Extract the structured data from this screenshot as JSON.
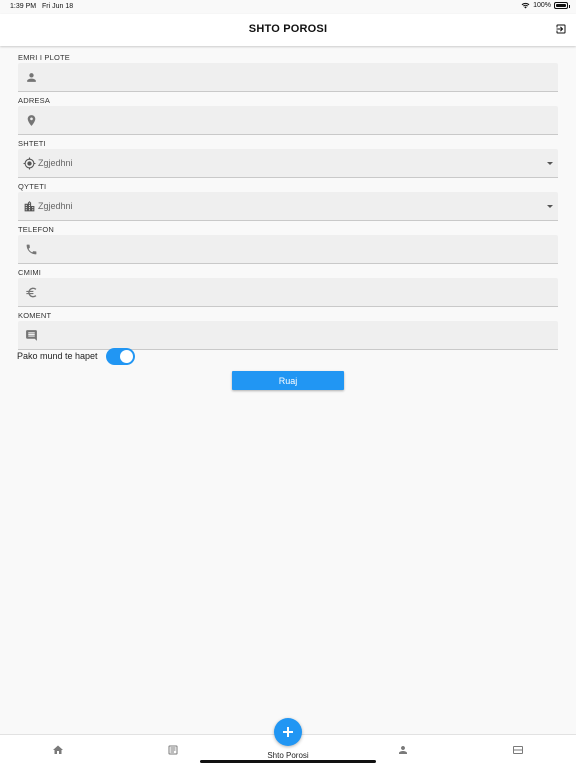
{
  "status_bar": {
    "time": "1:39 PM",
    "date": "Fri Jun 18",
    "battery": "100%"
  },
  "header": {
    "title": "SHTO POROSI"
  },
  "form": {
    "fields": [
      {
        "label": "EMRI I PLOTE",
        "icon": "person-icon",
        "value": ""
      },
      {
        "label": "ADRESA",
        "icon": "location-pin-icon",
        "value": ""
      },
      {
        "label": "SHTETI",
        "icon": "gps-target-icon",
        "selected": "Zgjedhni"
      },
      {
        "label": "QYTETI",
        "icon": "city-icon",
        "selected": "Zgjedhni"
      },
      {
        "label": "TELEFON",
        "icon": "phone-icon",
        "value": ""
      },
      {
        "label": "CMIMI",
        "icon": "euro-icon",
        "value": ""
      },
      {
        "label": "KOMENT",
        "icon": "comment-icon",
        "value": ""
      }
    ],
    "toggle": {
      "label": "Pako mund te hapet",
      "on": true
    },
    "save_label": "Ruaj"
  },
  "bottom_nav": {
    "fab_label": "Shto Porosi",
    "items": [
      "home-icon",
      "document-icon",
      "add-icon",
      "user-icon",
      "ticket-icon"
    ]
  },
  "colors": {
    "accent": "#2196f3",
    "field_bg": "#efefef",
    "page_bg": "#f9f9f9"
  }
}
